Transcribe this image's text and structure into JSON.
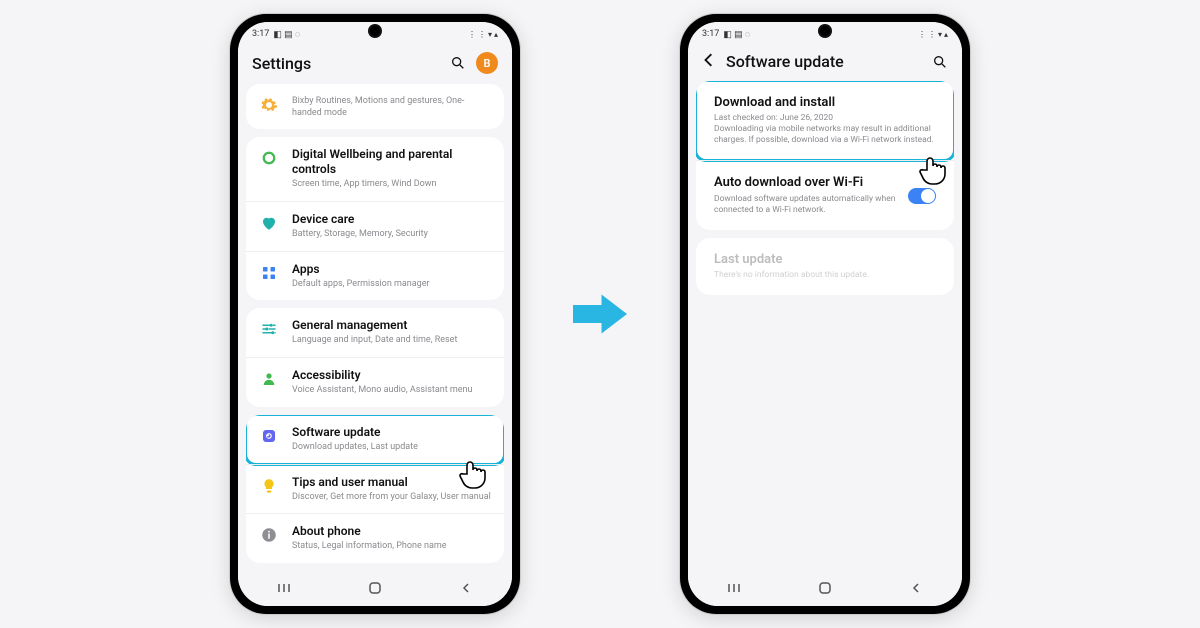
{
  "status": {
    "time": "3:17",
    "left_icons": "◧ ▤ ◌",
    "right_icons": "⋮ ⋮ ▾ ▴"
  },
  "left": {
    "header_title": "Settings",
    "avatar_initial": "B",
    "groups": [
      {
        "items": [
          {
            "icon": "gear",
            "color": "i-orange",
            "title_bind": "left.g0i0t",
            "sub_bind": "left.g0i0s"
          }
        ]
      },
      {
        "items": [
          {
            "icon": "ring",
            "color": "i-green",
            "title_bind": "left.g1i0t",
            "sub_bind": "left.g1i0s"
          },
          {
            "icon": "heart",
            "color": "i-teal",
            "title_bind": "left.g1i1t",
            "sub_bind": "left.g1i1s"
          },
          {
            "icon": "grid",
            "color": "i-blue",
            "title_bind": "left.g1i2t",
            "sub_bind": "left.g1i2s"
          }
        ]
      },
      {
        "items": [
          {
            "icon": "sliders",
            "color": "i-teal",
            "title_bind": "left.g2i0t",
            "sub_bind": "left.g2i0s"
          },
          {
            "icon": "person",
            "color": "i-green",
            "title_bind": "left.g2i1t",
            "sub_bind": "left.g2i1s"
          }
        ]
      },
      {
        "items": [
          {
            "icon": "refresh",
            "color": "i-purple",
            "title_bind": "left.g3i0t",
            "sub_bind": "left.g3i0s",
            "highlight": true
          },
          {
            "icon": "bulb",
            "color": "i-yellow",
            "title_bind": "left.g3i1t",
            "sub_bind": "left.g3i1s"
          },
          {
            "icon": "info",
            "color": "i-gray",
            "title_bind": "left.g3i2t",
            "sub_bind": "left.g3i2s"
          }
        ]
      }
    ],
    "g0i0t": "",
    "g0i0s": "Bixby Routines, Motions and gestures, One-handed mode",
    "g1i0t": "Digital Wellbeing and parental controls",
    "g1i0s": "Screen time, App timers, Wind Down",
    "g1i1t": "Device care",
    "g1i1s": "Battery, Storage, Memory, Security",
    "g1i2t": "Apps",
    "g1i2s": "Default apps, Permission manager",
    "g2i0t": "General management",
    "g2i0s": "Language and input, Date and time, Reset",
    "g2i1t": "Accessibility",
    "g2i1s": "Voice Assistant, Mono audio, Assistant menu",
    "g3i0t": "Software update",
    "g3i0s": "Download updates, Last update",
    "g3i1t": "Tips and user manual",
    "g3i1s": "Discover, Get more from your Galaxy, User manual",
    "g3i2t": "About phone",
    "g3i2s": "Status, Legal information, Phone name"
  },
  "right": {
    "header_title": "Software update",
    "r0t": "Download and install",
    "r0s": "Last checked on: June 26, 2020\nDownloading via mobile networks may result in additional charges. If possible, download via a Wi-Fi network instead.",
    "r1t": "Auto download over Wi-Fi",
    "r1s": "Download software updates automatically when connected to a Wi-Fi network.",
    "r2t": "Last update",
    "r2s": "There's no information about this update."
  }
}
